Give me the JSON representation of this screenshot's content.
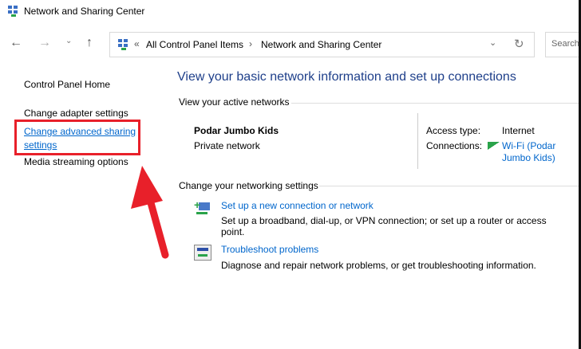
{
  "window": {
    "title": "Network and Sharing Center"
  },
  "address": {
    "prefix": "«",
    "crumbs": [
      "All Control Panel Items",
      "Network and Sharing Center"
    ],
    "search_placeholder": "Search"
  },
  "sidebar": {
    "items": [
      {
        "label": "Control Panel Home"
      },
      {
        "label": "Change adapter settings"
      },
      {
        "label": "Change advanced sharing settings"
      },
      {
        "label": "Media streaming options"
      }
    ]
  },
  "main": {
    "heading": "View your basic network information and set up connections",
    "active_label": "View your active networks",
    "network": {
      "name": "Podar Jumbo Kids",
      "type": "Private network",
      "access_label": "Access type:",
      "access_value": "Internet",
      "connections_label": "Connections:",
      "connections_value": "Wi-Fi (Podar Jumbo Kids)"
    },
    "change_label": "Change your networking settings",
    "tasks": [
      {
        "title": "Set up a new connection or network",
        "desc": "Set up a broadband, dial-up, or VPN connection; or set up a router or access point."
      },
      {
        "title": "Troubleshoot problems",
        "desc": "Diagnose and repair network problems, or get troubleshooting information."
      }
    ]
  },
  "colors": {
    "accent": "#0066cc",
    "annotation": "#e8202a"
  }
}
